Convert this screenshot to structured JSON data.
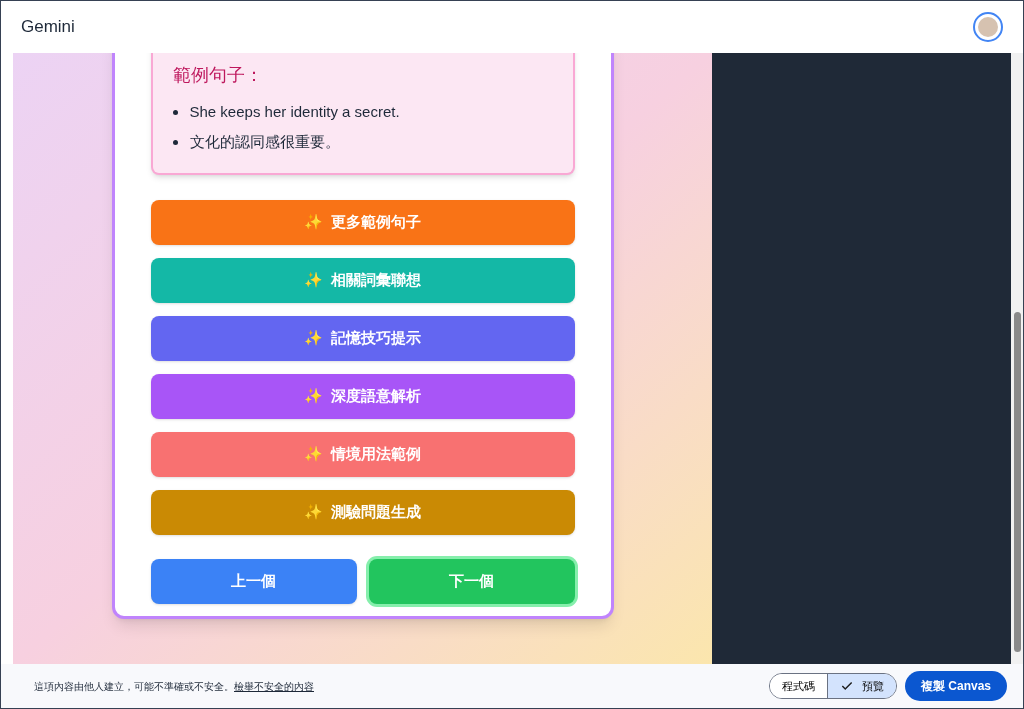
{
  "header": {
    "title": "Gemini"
  },
  "examples": {
    "heading": "範例句子：",
    "items": [
      "She keeps her identity a secret.",
      "文化的認同感很重要。"
    ]
  },
  "actions": [
    {
      "icon": "✨",
      "label": "更多範例句子",
      "color": "#f97316"
    },
    {
      "icon": "✨",
      "label": "相關詞彙聯想",
      "color": "#14b8a6"
    },
    {
      "icon": "✨",
      "label": "記憶技巧提示",
      "color": "#6366f1"
    },
    {
      "icon": "✨",
      "label": "深度語意解析",
      "color": "#a855f7"
    },
    {
      "icon": "✨",
      "label": "情境用法範例",
      "color": "#f87171"
    },
    {
      "icon": "✨",
      "label": "測驗問題生成",
      "color": "#ca8a04"
    }
  ],
  "navigation": [
    {
      "label": "上一個",
      "selected": false
    },
    {
      "label": "下一個",
      "selected": true
    }
  ],
  "footer": {
    "notice": "這項內容由他人建立，可能不準確或不安全。",
    "report_link": "檢舉不安全的內容",
    "view_tabs": [
      {
        "label": "程式碼",
        "selected": false
      },
      {
        "label": "預覽",
        "selected": true
      }
    ],
    "copy_button": "複製 Canvas"
  }
}
